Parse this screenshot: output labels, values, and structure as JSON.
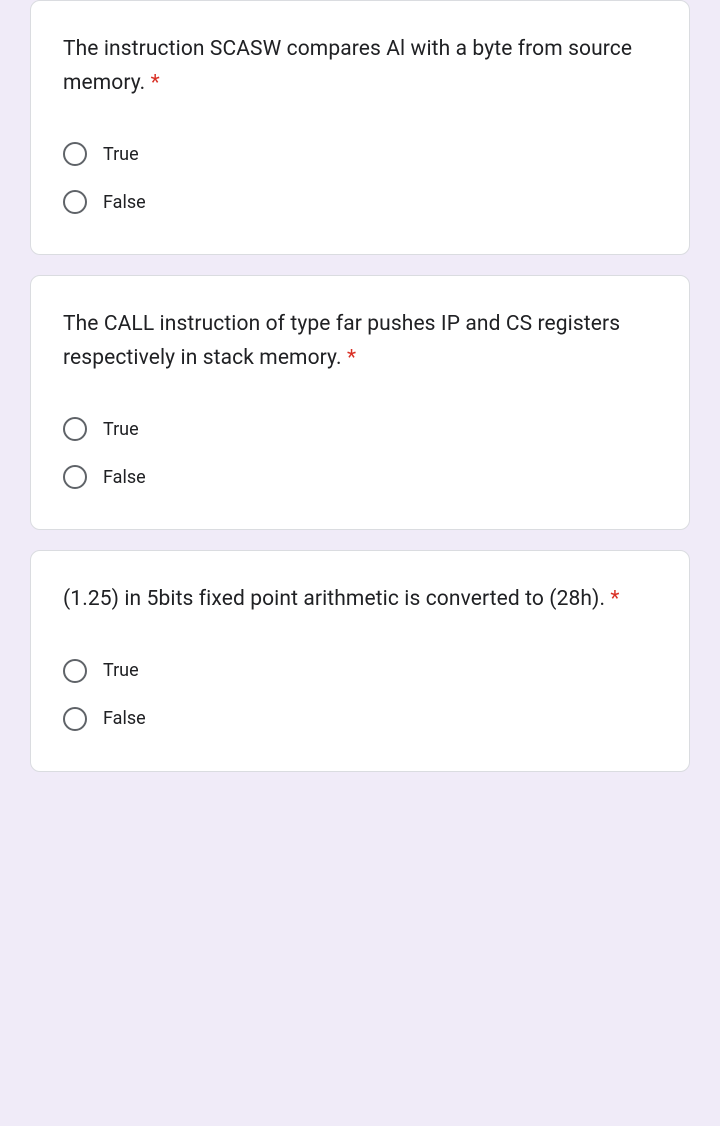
{
  "questions": [
    {
      "text": "The instruction SCASW compares Al with a byte from source memory.",
      "required": "*",
      "options": [
        "True",
        "False"
      ]
    },
    {
      "text": "The CALL instruction of type far pushes IP and CS registers respectively in stack memory.",
      "required": "*",
      "options": [
        "True",
        "False"
      ]
    },
    {
      "text": "(1.25) in 5bits fixed point arithmetic is converted to (28h).",
      "required": "*",
      "options": [
        "True",
        "False"
      ]
    }
  ]
}
